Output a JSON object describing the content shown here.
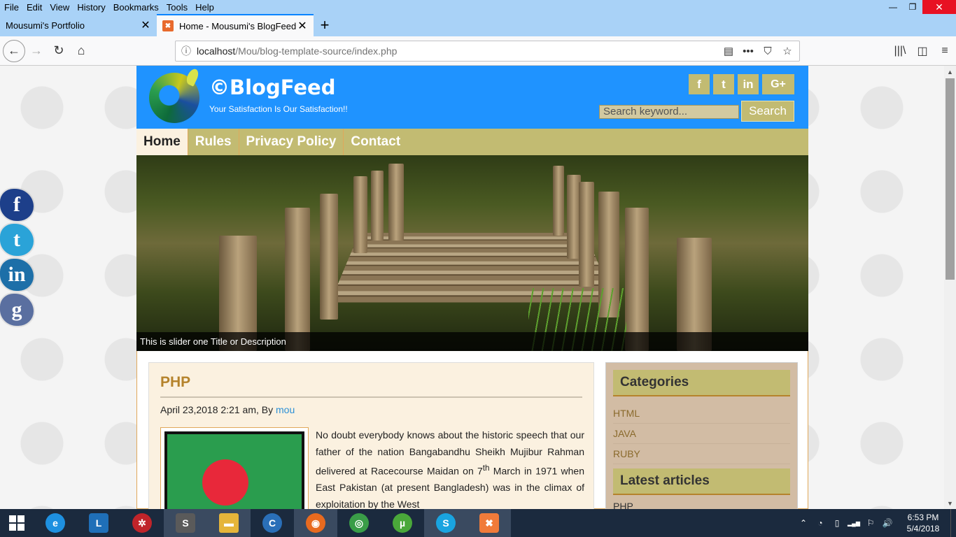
{
  "menubar": {
    "items": [
      "File",
      "Edit",
      "View",
      "History",
      "Bookmarks",
      "Tools",
      "Help"
    ]
  },
  "window_controls": {
    "minimize": "—",
    "restore": "❐",
    "close": "✕"
  },
  "tabs": [
    {
      "label": "Mousumi's Portfolio",
      "active": false
    },
    {
      "label": "Home - Mousumi's BlogFeed",
      "active": true
    }
  ],
  "new_tab": "+",
  "toolbar": {
    "back": "←",
    "forward": "→",
    "reload": "↻",
    "home": "⌂",
    "url_host": "localhost",
    "url_path": "/Mou/blog-template-source/index.php",
    "info_icon": "ⓘ",
    "reader_icon": "▤",
    "more_icon": "•••",
    "pocket_icon": "⛉",
    "bookmark_icon": "☆",
    "library_icon": "|||\\",
    "sidebar_icon": "◫",
    "menu_icon": "≡"
  },
  "site": {
    "title": "©BlogFeed",
    "tagline": "Your Satisfaction Is Our Satisfaction!!",
    "header_social": [
      "f",
      "t",
      "in",
      "G+"
    ],
    "search_placeholder": "Search keyword...",
    "search_button": "Search",
    "nav": [
      "Home",
      "Rules",
      "Privacy Policy",
      "Contact"
    ],
    "slider_caption": "This is slider one Title or Description",
    "float_social": [
      "f",
      "t",
      "in",
      "g"
    ],
    "float_social_colors": [
      "#1d3f8a",
      "#2aa3d8",
      "#1d6fa8",
      "#5a6fa0"
    ]
  },
  "post": {
    "title": "PHP",
    "date": "April 23,2018 2:21 am, By ",
    "author": "mou",
    "body_before_sup": "No doubt everybody knows about the historic speech that our father of the nation Bangabandhu Sheikh Mujibur Rahman delivered at Racecourse Maidan on 7",
    "body_sup": "th",
    "body_after_sup": " March in 1971 when East Pakistan (at present Bangladesh) was in the climax of exploitation by the West"
  },
  "sidebar": {
    "categories_title": "Categories",
    "categories": [
      "HTML",
      "JAVA",
      "RUBY"
    ],
    "latest_title": "Latest articles",
    "latest_first": "PHP"
  },
  "taskbar": {
    "apps": [
      {
        "name": "internet-explorer",
        "glyph": "e",
        "color": "#1e90e0"
      },
      {
        "name": "lync",
        "glyph": "L",
        "color": "#1f6fb8"
      },
      {
        "name": "app-red",
        "glyph": "✲",
        "color": "#c0242a"
      },
      {
        "name": "sublime-text",
        "glyph": "S",
        "color": "#5a5a5a"
      },
      {
        "name": "file-explorer",
        "glyph": "▬",
        "color": "#e5b53a"
      },
      {
        "name": "ccleaner",
        "glyph": "C",
        "color": "#2a6fb8"
      },
      {
        "name": "firefox",
        "glyph": "◉",
        "color": "#e86a1f"
      },
      {
        "name": "chrome",
        "glyph": "◎",
        "color": "#3a9d48"
      },
      {
        "name": "utorrent",
        "glyph": "µ",
        "color": "#4aa83a"
      },
      {
        "name": "skype",
        "glyph": "S",
        "color": "#19a4e0"
      },
      {
        "name": "xampp",
        "glyph": "✖",
        "color": "#f07b3a"
      }
    ],
    "tray_icons": [
      "⌃",
      "◔",
      "▯",
      "▂▄▆",
      "⚐",
      "🔊"
    ],
    "time": "6:53 PM",
    "date": "5/4/2018"
  }
}
